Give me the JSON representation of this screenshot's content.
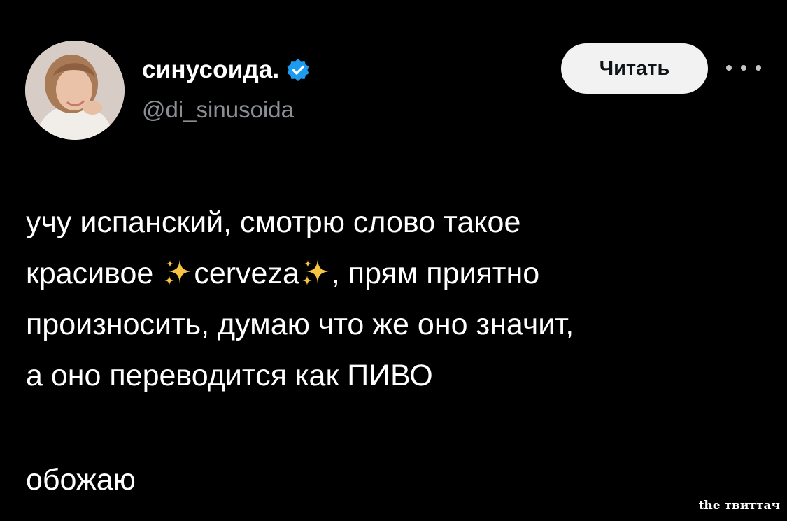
{
  "author": {
    "display_name": "синусоида.",
    "handle": "@di_sinusoida",
    "verified": true,
    "avatar_icon": "avatar-photo"
  },
  "actions": {
    "follow_label": "Читать",
    "more_icon": "more-horizontal-icon"
  },
  "tweet": {
    "line1": "учу испанский, смотрю слово такое",
    "line2_before": "красивое ",
    "line2_word": "cerveza",
    "line2_after": ", прям приятно",
    "line3": "произносить, думаю что же оно значит,",
    "line4": "а оно переводится как ПИВО",
    "line5": "обожаю",
    "emoji_icon": "sparkles-icon"
  },
  "watermark": "the твиттач",
  "colors": {
    "background": "#000000",
    "text": "#ffffff",
    "handle": "#8b8f94",
    "verified_badge": "#1d9bf0",
    "button_bg": "#f2f2f2",
    "sparkle": "#f5c542"
  }
}
